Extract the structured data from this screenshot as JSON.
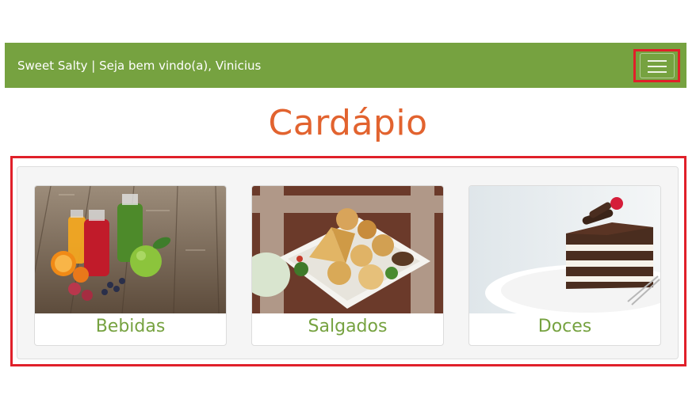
{
  "navbar": {
    "title": "Sweet Salty | Seja bem vindo(a), Vinicius",
    "menu_icon": "hamburger-menu-icon"
  },
  "main": {
    "title": "Cardápio"
  },
  "categories": [
    {
      "label": "Bebidas",
      "image": "juices-fruit-photo"
    },
    {
      "label": "Salgados",
      "image": "savory-snacks-photo"
    },
    {
      "label": "Doces",
      "image": "chocolate-cake-photo"
    }
  ],
  "colors": {
    "navbar_bg": "#76a240",
    "accent_orange": "#e2632f",
    "highlight_red": "#e0202a",
    "caption_green": "#76a240"
  }
}
